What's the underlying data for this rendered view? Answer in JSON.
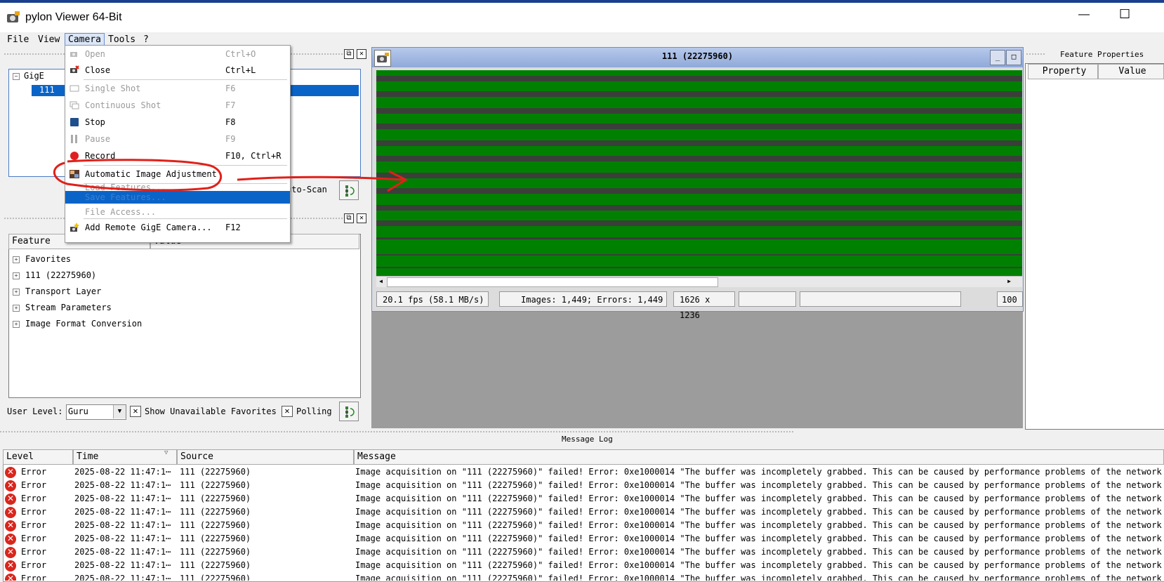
{
  "window": {
    "title": "pylon Viewer 64-Bit",
    "minimize_glyph": "—",
    "maximize_glyph": "☐"
  },
  "menubar": {
    "items": [
      "File",
      "View",
      "Camera",
      "Tools",
      "?"
    ]
  },
  "camera_menu": {
    "items": [
      {
        "label": "Open",
        "shortcut": "Ctrl+O",
        "enabled": false,
        "icon": "open-camera-icon"
      },
      {
        "label": "Close",
        "shortcut": "Ctrl+L",
        "enabled": true,
        "icon": "close-camera-icon"
      },
      {
        "label": "Single Shot",
        "shortcut": "F6",
        "enabled": false,
        "icon": "single-shot-icon"
      },
      {
        "label": "Continuous Shot",
        "shortcut": "F7",
        "enabled": false,
        "icon": "continuous-shot-icon"
      },
      {
        "label": "Stop",
        "shortcut": "F8",
        "enabled": true,
        "icon": "stop-icon"
      },
      {
        "label": "Pause",
        "shortcut": "F9",
        "enabled": false,
        "icon": "pause-icon"
      },
      {
        "label": "Record",
        "shortcut": "F10, Ctrl+R",
        "enabled": true,
        "icon": "record-icon"
      },
      {
        "label": "Automatic Image Adjustment",
        "shortcut": "",
        "enabled": true,
        "icon": "auto-adjust-icon"
      },
      {
        "label": "Load Features...",
        "shortcut": "",
        "enabled": false
      },
      {
        "label": "Save Features...",
        "shortcut": "",
        "enabled": false,
        "highlighted": true
      },
      {
        "label": "File Access...",
        "shortcut": "",
        "enabled": false
      },
      {
        "label": "Add Remote GigE Camera...",
        "shortcut": "F12",
        "enabled": true,
        "icon": "add-remote-camera-icon"
      }
    ]
  },
  "devices_panel": {
    "tree": [
      "GigE",
      "111"
    ],
    "auto_scan_label": "uto-Scan"
  },
  "features_panel": {
    "columns": [
      "Feature",
      "Value"
    ],
    "items": [
      "Favorites",
      "111 (22275960)",
      "Transport Layer",
      "Stream Parameters",
      "Image Format Conversion"
    ],
    "user_level_label": "User Level:",
    "user_level_value": "Guru",
    "show_unavailable_label": "Show Unavailable Favorites",
    "polling_label": "Polling"
  },
  "image_window": {
    "title": "111 (22275960)",
    "fps": "20.1 fps (58.1 MB/s)",
    "counts": "Images: 1,449; Errors: 1,449",
    "resolution": "1626 x 1236",
    "zoom": "100"
  },
  "feature_properties": {
    "title": "Feature Properties",
    "columns": [
      "Property",
      "Value"
    ]
  },
  "message_log": {
    "title": "Message Log",
    "columns": [
      "Level",
      "Time",
      "Source",
      "Message"
    ],
    "rows": [
      {
        "level": "Error",
        "time": "2025-08-22 11:47:1⋯",
        "source": "111 (22275960)",
        "message": "Image acquisition on \"111 (22275960)\" failed! Error: 0xe1000014 \"The buffer was incompletely grabbed. This can be caused by performance problems of the network hardw"
      },
      {
        "level": "Error",
        "time": "2025-08-22 11:47:1⋯",
        "source": "111 (22275960)",
        "message": "Image acquisition on \"111 (22275960)\" failed! Error: 0xe1000014 \"The buffer was incompletely grabbed. This can be caused by performance problems of the network hardw"
      },
      {
        "level": "Error",
        "time": "2025-08-22 11:47:1⋯",
        "source": "111 (22275960)",
        "message": "Image acquisition on \"111 (22275960)\" failed! Error: 0xe1000014 \"The buffer was incompletely grabbed. This can be caused by performance problems of the network hardw"
      },
      {
        "level": "Error",
        "time": "2025-08-22 11:47:1⋯",
        "source": "111 (22275960)",
        "message": "Image acquisition on \"111 (22275960)\" failed! Error: 0xe1000014 \"The buffer was incompletely grabbed. This can be caused by performance problems of the network hardw"
      },
      {
        "level": "Error",
        "time": "2025-08-22 11:47:1⋯",
        "source": "111 (22275960)",
        "message": "Image acquisition on \"111 (22275960)\" failed! Error: 0xe1000014 \"The buffer was incompletely grabbed. This can be caused by performance problems of the network hardw"
      },
      {
        "level": "Error",
        "time": "2025-08-22 11:47:1⋯",
        "source": "111 (22275960)",
        "message": "Image acquisition on \"111 (22275960)\" failed! Error: 0xe1000014 \"The buffer was incompletely grabbed. This can be caused by performance problems of the network hardw"
      },
      {
        "level": "Error",
        "time": "2025-08-22 11:47:1⋯",
        "source": "111 (22275960)",
        "message": "Image acquisition on \"111 (22275960)\" failed! Error: 0xe1000014 \"The buffer was incompletely grabbed. This can be caused by performance problems of the network hardw"
      },
      {
        "level": "Error",
        "time": "2025-08-22 11:47:1⋯",
        "source": "111 (22275960)",
        "message": "Image acquisition on \"111 (22275960)\" failed! Error: 0xe1000014 \"The buffer was incompletely grabbed. This can be caused by performance problems of the network hardw"
      },
      {
        "level": "Error",
        "time": "2025-08-22 11:47:1⋯",
        "source": "111 (22275960)",
        "message": "Image acquisition on \"111 (22275960)\" failed! Error: 0xe1000014 \"The buffer was incompletely grabbed. This can be caused by performance problems of the network hardw"
      }
    ]
  },
  "colors": {
    "image_green": "#008000",
    "annotation_red": "#e0201a",
    "selection_blue": "#0a64c8"
  }
}
